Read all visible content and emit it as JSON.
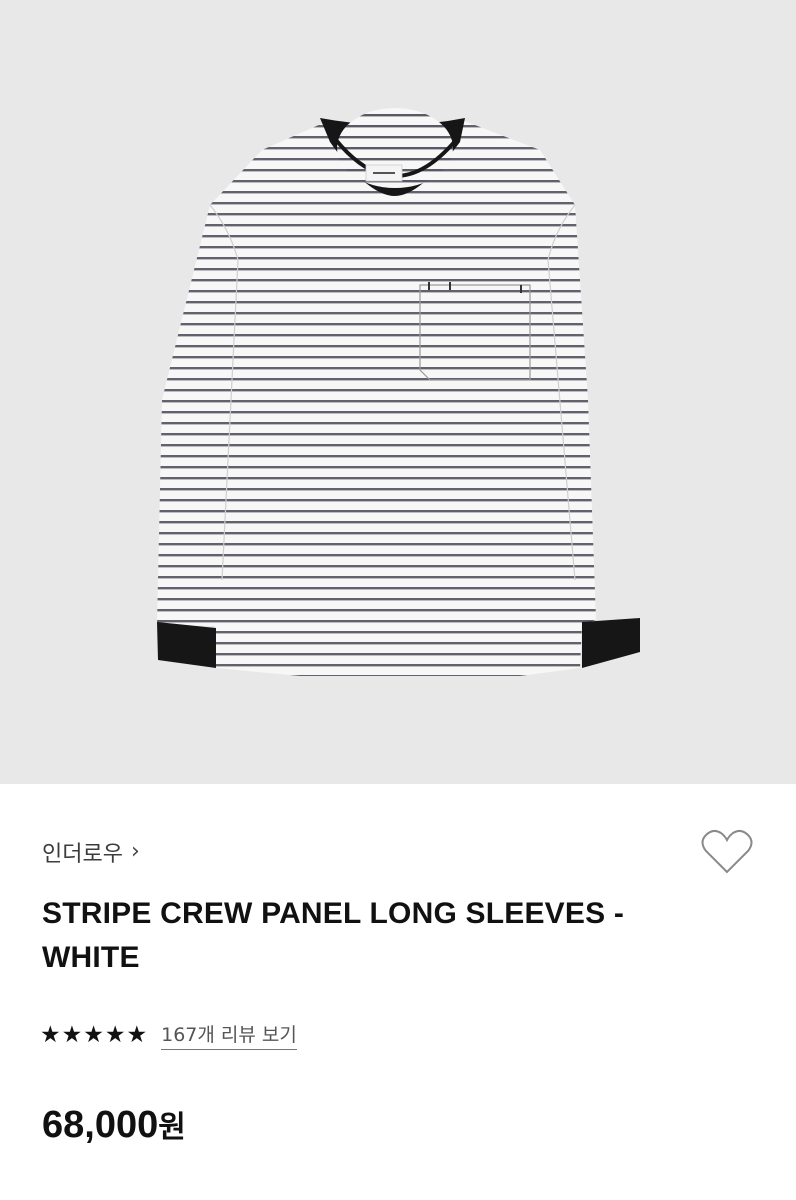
{
  "product": {
    "image_alt": "Striped long sleeve t-shirt",
    "brand": "인더로우",
    "title_line1": "STRIPE CREW PANEL LONG SLEEVES -",
    "title_line2": "WHITE",
    "rating": 5,
    "rating_max": 5,
    "review_link": "167개 리뷰 보기",
    "price": "68,000",
    "price_unit": "원"
  },
  "icons": {
    "brand_chevron": "chevron-right-icon",
    "wishlist": "heart-outline-icon",
    "star": "star-filled-icon"
  },
  "colors": {
    "image_bg": "#e8e8e8",
    "text": "#111111",
    "muted": "#555555"
  }
}
